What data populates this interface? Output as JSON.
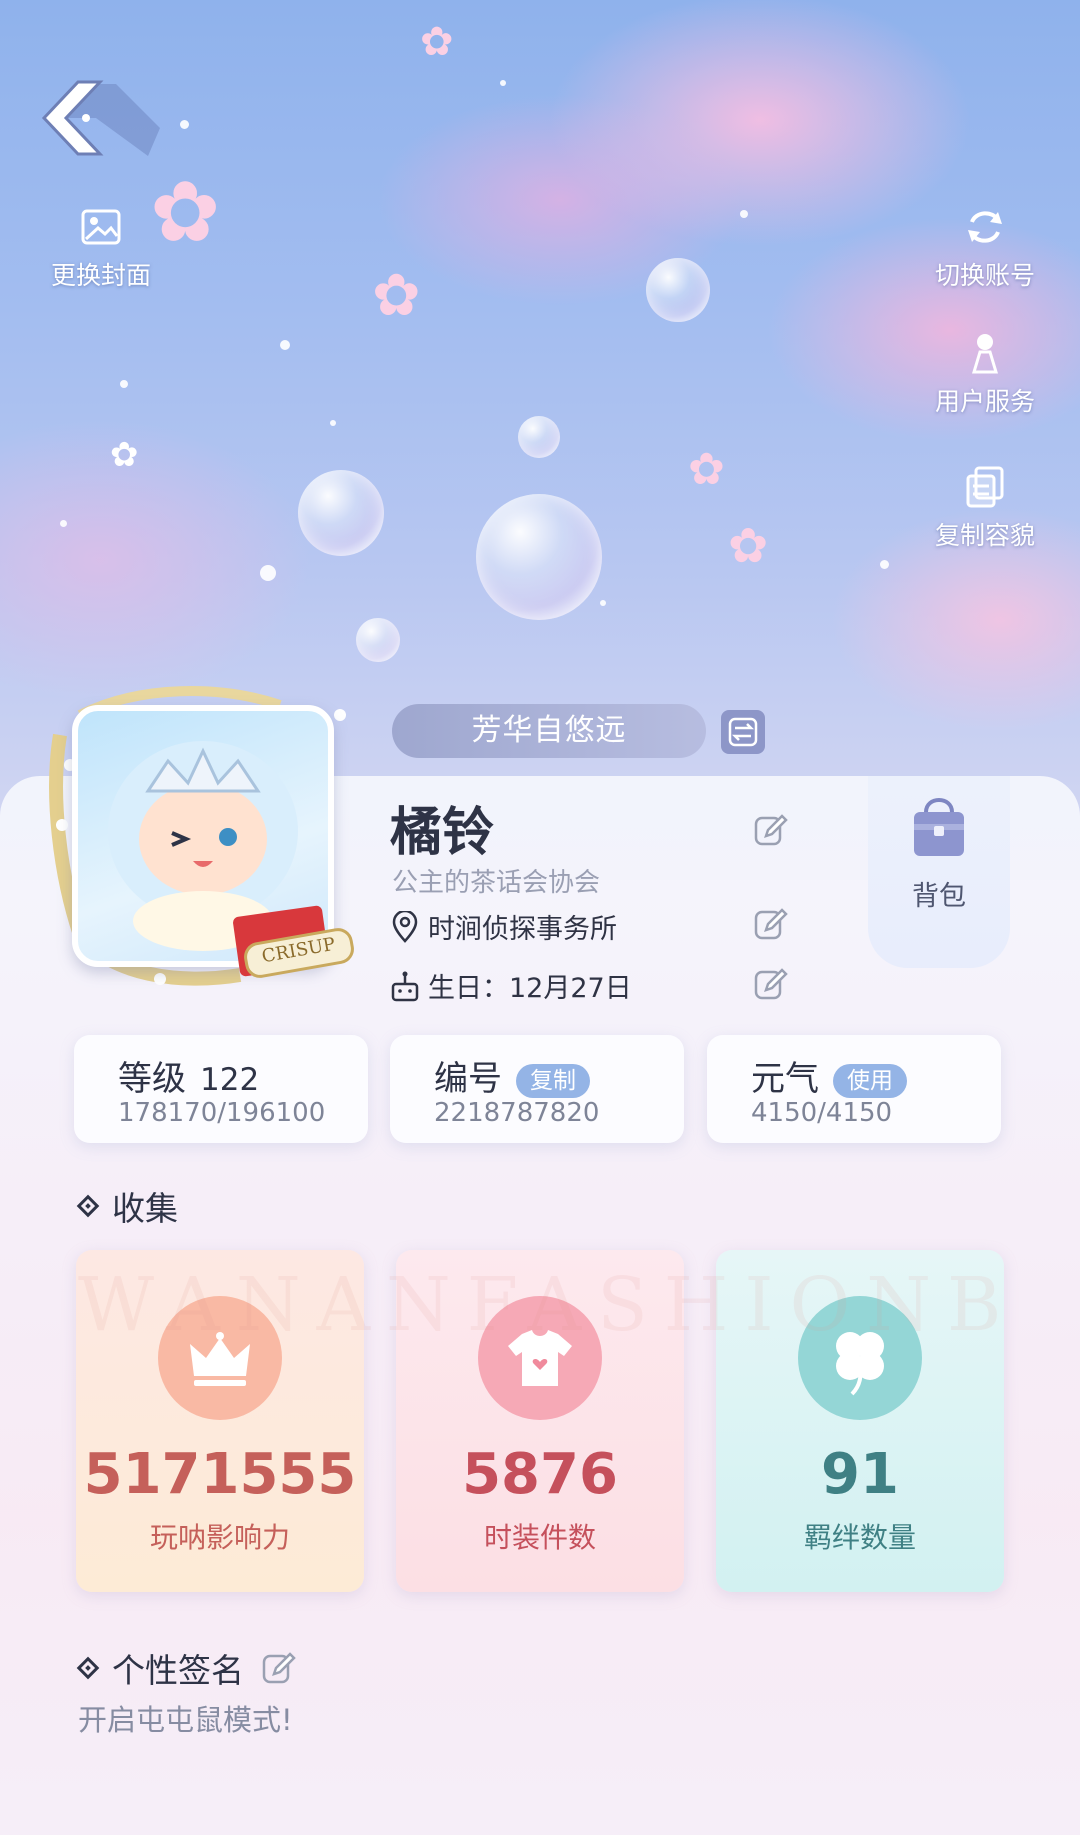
{
  "top": {
    "change_cover": "更换封面",
    "switch_account": "切换账号",
    "user_service": "用户服务",
    "copy_appearance": "复制容貌"
  },
  "profile": {
    "title_badge": "芳华自悠远",
    "name": "橘铃",
    "guild": "公主的茶话会协会",
    "location": "时涧侦探事务所",
    "birthday": "生日：12月27日",
    "bag": "背包",
    "avatar_frame_text": "CRISUP"
  },
  "stats": [
    {
      "title": "等级",
      "value": "122",
      "sub": "178170/196100"
    },
    {
      "title": "编号",
      "action": "复制",
      "sub": "2218787820"
    },
    {
      "title": "元气",
      "action": "使用",
      "sub": "4150/4150"
    }
  ],
  "collection": {
    "heading": "收集",
    "watermark": "WANANFASHIONBOND",
    "items": [
      {
        "value": "5171555",
        "label": "玩呐影响力",
        "icon": "crown-icon"
      },
      {
        "value": "5876",
        "label": "时装件数",
        "icon": "tshirt-icon"
      },
      {
        "value": "91",
        "label": "羁绊数量",
        "icon": "clover-icon"
      }
    ]
  },
  "signature": {
    "heading": "个性签名",
    "text": "开启屯屯鼠模式!"
  },
  "colors": {
    "sky_top": "#8fb2ec",
    "accent_pill": "#94b4e6",
    "influence": "#c5605a",
    "fashion": "#c5505c",
    "bond": "#3f8084"
  }
}
